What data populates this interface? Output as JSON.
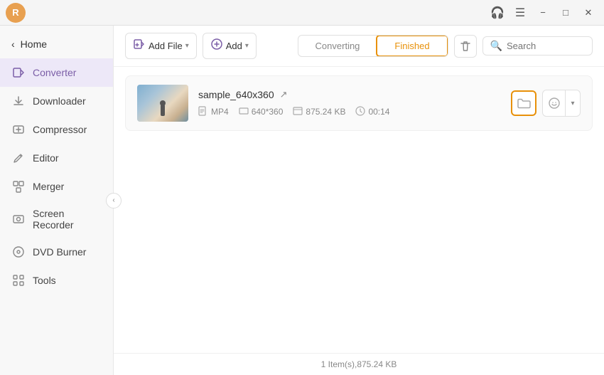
{
  "titlebar": {
    "avatar_initials": "R",
    "minimize_label": "−",
    "maximize_label": "□",
    "close_label": "✕",
    "headphones_label": "🎧",
    "menu_label": "☰"
  },
  "sidebar": {
    "home_label": "Home",
    "items": [
      {
        "id": "converter",
        "label": "Converter",
        "icon": "⚡",
        "active": true
      },
      {
        "id": "downloader",
        "label": "Downloader",
        "icon": "⬇"
      },
      {
        "id": "compressor",
        "label": "Compressor",
        "icon": "🗜"
      },
      {
        "id": "editor",
        "label": "Editor",
        "icon": "✂"
      },
      {
        "id": "merger",
        "label": "Merger",
        "icon": "⊕"
      },
      {
        "id": "screen-recorder",
        "label": "Screen Recorder",
        "icon": "⊞"
      },
      {
        "id": "dvd-burner",
        "label": "DVD Burner",
        "icon": "💿"
      },
      {
        "id": "tools",
        "label": "Tools",
        "icon": "⚙"
      }
    ]
  },
  "toolbar": {
    "add_file_label": "Add File",
    "add_btn_label": "Add",
    "converting_tab": "Converting",
    "finished_tab": "Finished",
    "search_placeholder": "Search"
  },
  "file": {
    "name": "sample_640x360",
    "format": "MP4",
    "resolution": "640*360",
    "size": "875.24 KB",
    "duration": "00:14"
  },
  "statusbar": {
    "summary": "1 Item(s),875.24 KB"
  }
}
